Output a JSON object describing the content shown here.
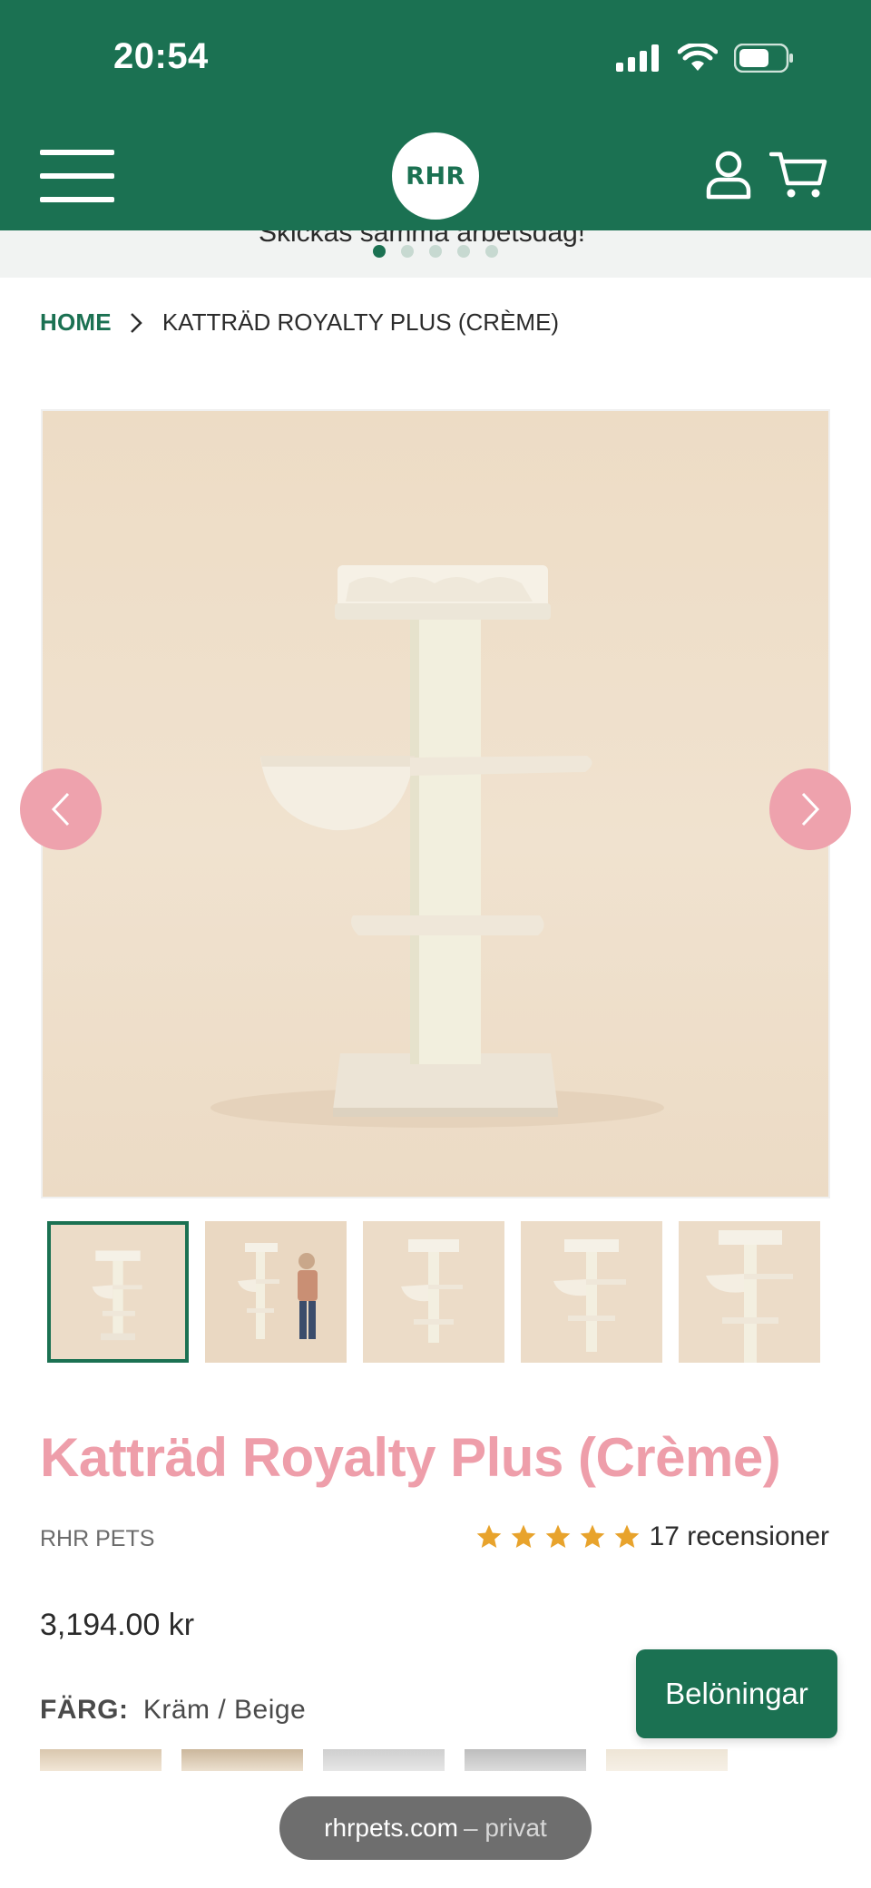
{
  "status_bar": {
    "time": "20:54"
  },
  "header": {
    "logo_text": "RHR",
    "brand_color": "#1b7152"
  },
  "promo": {
    "text": "Skickas samma arbetsdag!",
    "slide_count": 5,
    "active_index": 0
  },
  "breadcrumb": {
    "home": "HOME",
    "current": "KATTRÄD ROYALTY PLUS (CRÈME)"
  },
  "product": {
    "title": "Katträd Royalty Plus (Crème)",
    "vendor": "RHR PETS",
    "rating_stars": 5,
    "rating_text": "17 recensioner",
    "price": "3,194.00 kr",
    "color_label": "FÄRG:",
    "color_value": "Kräm / Beige",
    "accent_color": "#ee9eaa",
    "star_color": "#e8a32c"
  },
  "gallery": {
    "thumbnail_count": 5,
    "active_thumbnail": 0
  },
  "rewards": {
    "label": "Belöningar"
  },
  "browser": {
    "domain": "rhrpets.com",
    "mode": "– privat"
  }
}
